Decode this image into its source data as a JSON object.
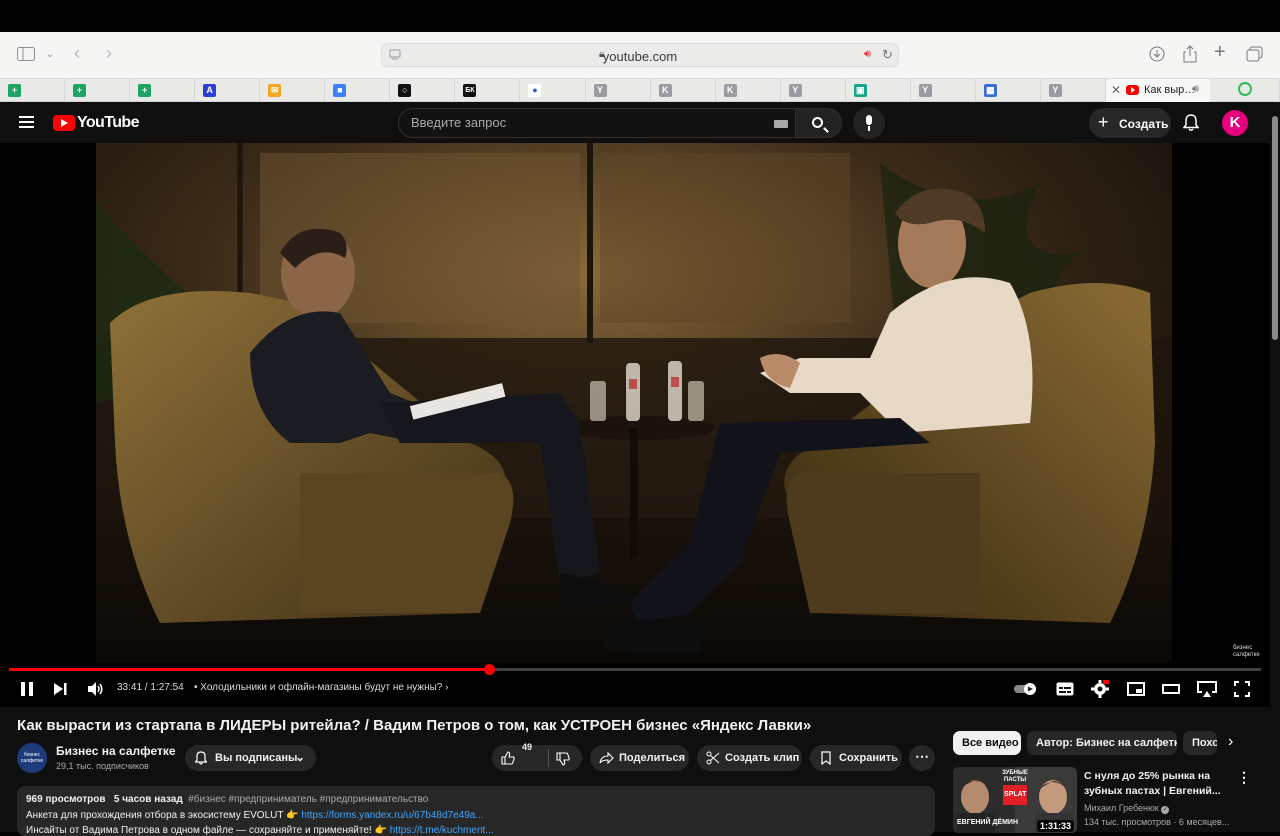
{
  "browser": {
    "url": "youtube.com",
    "active_tab_title": "Как выр…"
  },
  "pinned_tabs": [
    {
      "icon": "sheets-icon",
      "color": "#1ea362",
      "glyph": "+"
    },
    {
      "icon": "sheets-icon",
      "color": "#1ea362",
      "glyph": "+"
    },
    {
      "icon": "sheets-icon",
      "color": "#1ea362",
      "glyph": "+"
    },
    {
      "icon": "app-icon",
      "color": "#2b3fd6",
      "glyph": "A"
    },
    {
      "icon": "mail-icon",
      "color": "#f5a623",
      "glyph": "✉"
    },
    {
      "icon": "cube-icon",
      "color": "#3b82f6",
      "glyph": "■"
    },
    {
      "icon": "circle-icon",
      "color": "#111111",
      "glyph": "○"
    },
    {
      "icon": "bk-icon",
      "color": "#111111",
      "glyph": "БК"
    },
    {
      "icon": "record-icon",
      "color": "#ffffff",
      "glyph": "●"
    },
    {
      "icon": "y-icon",
      "color": "#8e8e93",
      "glyph": "Y"
    },
    {
      "icon": "k-icon",
      "color": "#8e8e93",
      "glyph": "K"
    },
    {
      "icon": "k-icon",
      "color": "#8e8e93",
      "glyph": "K"
    },
    {
      "icon": "y-icon",
      "color": "#8e8e93",
      "glyph": "Y"
    },
    {
      "icon": "chart-icon",
      "color": "#17a589",
      "glyph": "▣"
    },
    {
      "icon": "y-icon",
      "color": "#8e8e93",
      "glyph": "Y"
    },
    {
      "icon": "table-icon",
      "color": "#3b6fd6",
      "glyph": "▦"
    },
    {
      "icon": "y-icon",
      "color": "#8e8e93",
      "glyph": "Y"
    }
  ],
  "youtube": {
    "logo": "YouTube",
    "search_placeholder": "Введите запрос",
    "create_label": "Создать",
    "avatar_letter": "K"
  },
  "player": {
    "current_time": "33:41",
    "duration": "1:27:54",
    "time_display": "33:41 / 1:27:54",
    "chapter": "Холодильники и офлайн-магазины будут не нужны?",
    "progress_fraction": 0.383,
    "watermark": "бизнес\nсалфетке"
  },
  "video": {
    "title": "Как вырасти из стартапа в ЛИДЕРЫ ритейла? / Вадим Петров о том, как УСТРОЕН бизнес «Яндекс Лавки»",
    "channel_name": "Бизнес на салфетке",
    "channel_avatar_text": "бизнес салфетке",
    "subscribers": "29,1 тыс. подписчиков",
    "subscribed_label": "Вы подписаны",
    "likes": "49",
    "share_label": "Поделиться",
    "clip_label": "Создать клип",
    "save_label": "Сохранить"
  },
  "description": {
    "views": "969 просмотров",
    "posted": "5 часов назад",
    "tags": "#бизнес #предприниматель #предпринимательство",
    "line2_text": "Анкета для прохождения отбора в экосистему EVOLUT 👉 ",
    "line2_link": "https://forms.yandex.ru/u/67b48d7e49a...",
    "line3_text": "Инсайты от Вадима Петрова в одном файле — сохраняйте и применяйте! 👉 ",
    "line3_link": "https://t.me/kuchment..."
  },
  "related": {
    "chips": [
      "Все видео",
      "Автор: Бизнес на салфетке",
      "Похо"
    ],
    "items": [
      {
        "title": "С нуля до 25% рынка на зубных пастах | Евгений...",
        "channel": "Михаил Гребенюк",
        "meta": "134 тыс. просмотров · 6 месяцев...",
        "duration": "1:31:33",
        "thumb_text": "ЗУБНЫЕ ПАСТЫ",
        "thumb_logo": "SPLAT",
        "thumb_caption": "ЕВГЕНИЙ ДЁМИН"
      }
    ]
  }
}
